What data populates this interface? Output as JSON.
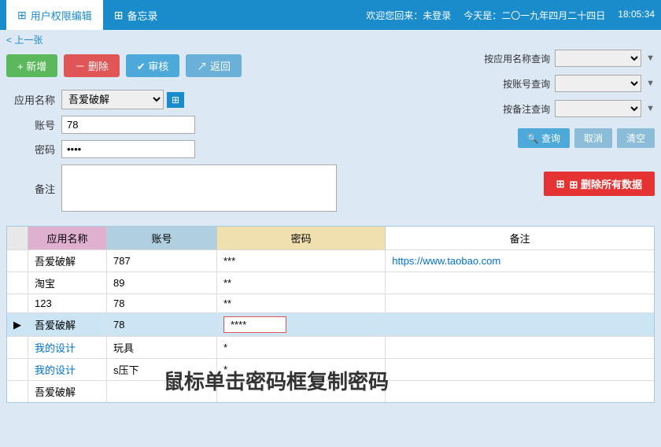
{
  "topbar": {
    "tab1_icon": "⊞",
    "tab1_label": "用户权限编辑",
    "tab2_icon": "⊞",
    "tab2_label": "备忘录",
    "welcome": "欢迎您回来：未登录",
    "date_label": "今天是：二〇一九年四月二十四日",
    "time": "18:05:34"
  },
  "breadcrumb": "< 上一张",
  "toolbar": {
    "add_label": "+ 新增",
    "delete_label": "－ 删除",
    "review_label": "✔ 审核",
    "return_label": "↗ 返回"
  },
  "form": {
    "app_name_label": "应用名称",
    "app_name_value": "吾爱破解",
    "account_label": "账号",
    "account_value": "78",
    "password_label": "密码",
    "password_value": "••••",
    "note_label": "备注",
    "note_value": ""
  },
  "search_panel": {
    "by_app_label": "按应用名称查询",
    "by_account_label": "按账号查询",
    "by_note_label": "按备注查询",
    "query_btn": "查询",
    "cancel_btn": "取消",
    "clear_btn": "清空"
  },
  "delete_all_btn": "⊞ 删除所有数据",
  "table": {
    "headers": [
      "应用名称",
      "账号",
      "密码",
      "备注"
    ],
    "rows": [
      {
        "arrow": "",
        "app": "吾爱破解",
        "account": "787",
        "password": "***",
        "note": "https://www.taobao.com",
        "selected": false
      },
      {
        "arrow": "",
        "app": "淘宝",
        "account": "89",
        "password": "**",
        "note": "",
        "selected": false
      },
      {
        "arrow": "",
        "app": "123",
        "account": "78",
        "password": "**",
        "note": "",
        "selected": false
      },
      {
        "arrow": "▶",
        "app": "吾爱破解",
        "account": "78",
        "password": "****",
        "note": "",
        "selected": true
      },
      {
        "arrow": "",
        "app": "我的设计",
        "account": "玩具",
        "password": "*",
        "note": "",
        "selected": false
      },
      {
        "arrow": "",
        "app": "我的设计",
        "account": "s压下",
        "password": "*",
        "note": "",
        "selected": false
      },
      {
        "arrow": "",
        "app": "吾爱破解",
        "account": "",
        "password": "",
        "note": "",
        "selected": false
      }
    ]
  },
  "hint_text": "鼠标单击密码框复制密码",
  "colors": {
    "accent": "#1a8ccc",
    "link": "#0070cc"
  }
}
